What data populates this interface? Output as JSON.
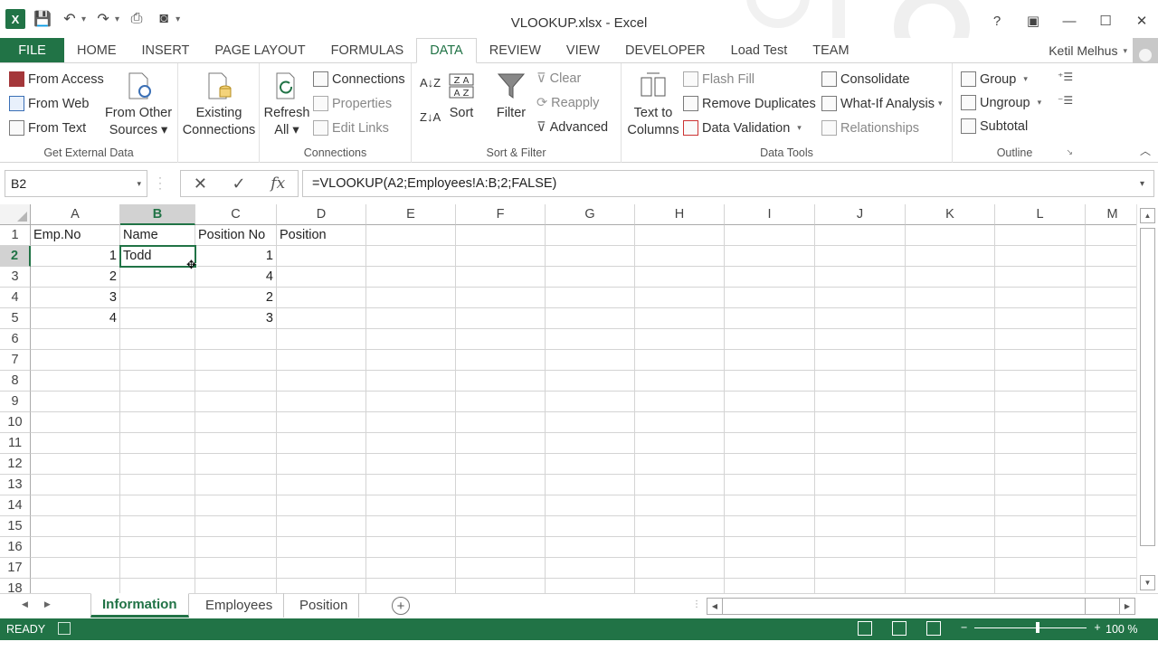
{
  "window": {
    "title": "VLOOKUP.xlsx - Excel",
    "logo": "X",
    "controls": [
      "?",
      "▣",
      "—",
      "☐",
      "✕"
    ]
  },
  "qat": {
    "save_icon": "💾",
    "undo_icon": "↶",
    "redo_icon": "↷",
    "customize_icon": "▾"
  },
  "tabs": [
    "FILE",
    "HOME",
    "INSERT",
    "PAGE LAYOUT",
    "FORMULAS",
    "DATA",
    "REVIEW",
    "VIEW",
    "DEVELOPER",
    "Load Test",
    "TEAM"
  ],
  "active_tab": "DATA",
  "user": {
    "name": "Ketil Melhus"
  },
  "ribbon": {
    "get_external": {
      "label": "Get External Data",
      "from_access": "From Access",
      "from_web": "From Web",
      "from_text": "From Text",
      "from_other_l1": "From Other",
      "from_other_l2": "Sources ▾",
      "existing_l1": "Existing",
      "existing_l2": "Connections"
    },
    "connections": {
      "label": "Connections",
      "refresh_l1": "Refresh",
      "refresh_l2": "All ▾",
      "connections": "Connections",
      "properties": "Properties",
      "edit_links": "Edit Links"
    },
    "sort_filter": {
      "label": "Sort & Filter",
      "az": "A↓Z",
      "za": "Z↓A",
      "sort": "Sort",
      "filter": "Filter",
      "clear": "Clear",
      "reapply": "Reapply",
      "advanced": "Advanced"
    },
    "data_tools": {
      "label": "Data Tools",
      "text_to_l1": "Text to",
      "text_to_l2": "Columns",
      "flash_fill": "Flash Fill",
      "remove_dup": "Remove Duplicates",
      "data_validation": "Data Validation",
      "data_validation_arrow": "▾",
      "consolidate": "Consolidate",
      "what_if": "What-If Analysis",
      "what_if_arrow": "▾",
      "relationships": "Relationships"
    },
    "outline": {
      "label": "Outline",
      "group": "Group",
      "group_arrow": "▾",
      "ungroup": "Ungroup",
      "ungroup_arrow": "▾",
      "subtotal": "Subtotal"
    }
  },
  "formula_bar": {
    "name_box": "B2",
    "cancel": "✕",
    "enter": "✓",
    "fx": "fx",
    "formula": "=VLOOKUP(A2;Employees!A:B;2;FALSE)"
  },
  "grid": {
    "columns": [
      "A",
      "B",
      "C",
      "D",
      "E",
      "F",
      "G",
      "H",
      "I",
      "J",
      "K",
      "L",
      "M"
    ],
    "rows": [
      "1",
      "2",
      "3",
      "4",
      "5",
      "6",
      "7",
      "8",
      "9",
      "10",
      "11",
      "12",
      "13",
      "14",
      "15",
      "16",
      "17",
      "18"
    ],
    "selected_col": "B",
    "selected_row": "2",
    "cells": {
      "A1": "Emp.No",
      "B1": "Name",
      "C1": "Position No",
      "D1": "Position",
      "A2": "1",
      "B2": "Todd",
      "C2": "1",
      "A3": "2",
      "C3": "4",
      "A4": "3",
      "C4": "2",
      "A5": "4",
      "C5": "3"
    }
  },
  "sheets": [
    "Information",
    "Employees",
    "Position"
  ],
  "active_sheet": "Information",
  "status": {
    "ready": "READY",
    "zoom": "100 %",
    "zoom_level": 1.0
  },
  "colors": {
    "accent": "#217346",
    "grid_line": "#d4d4d4",
    "header_sel": "#d2d2d2"
  }
}
